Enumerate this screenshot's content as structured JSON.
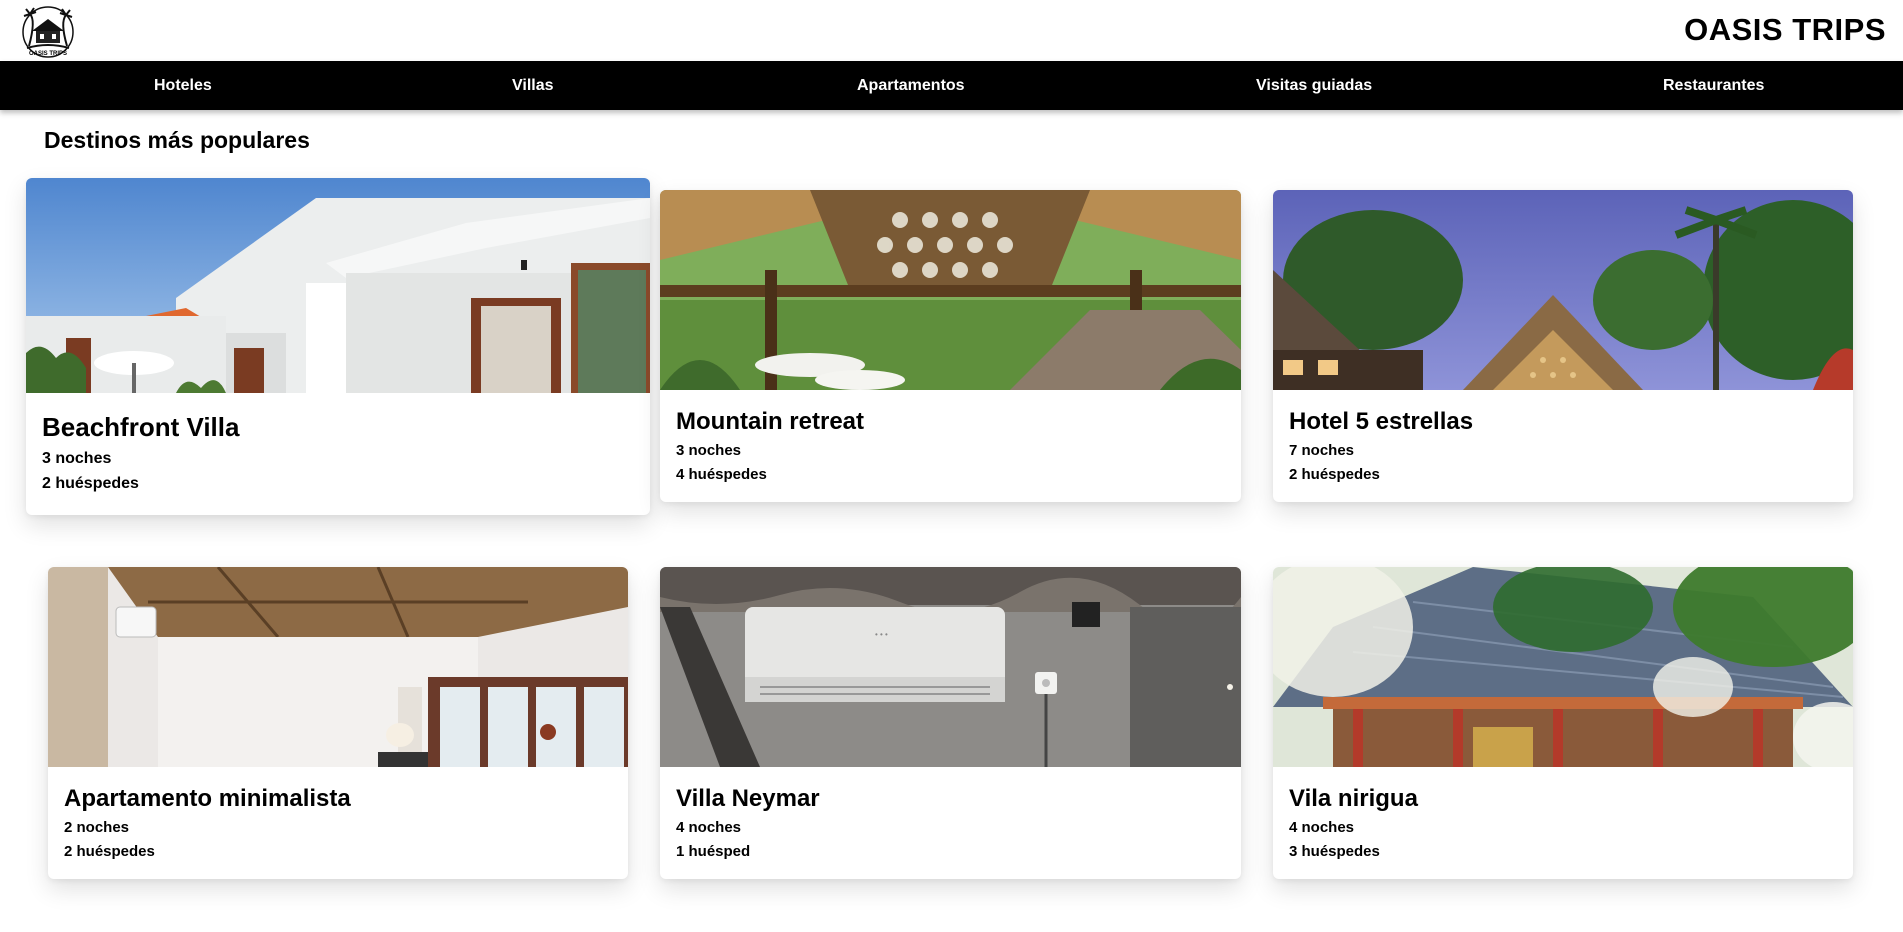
{
  "header": {
    "brand": "OASIS TRIPS",
    "logo_icon": "palm-tree-hut-logo"
  },
  "nav": {
    "items": [
      {
        "label": "Hoteles"
      },
      {
        "label": "Villas"
      },
      {
        "label": "Apartamentos"
      },
      {
        "label": "Visitas guiadas"
      },
      {
        "label": "Restaurantes"
      }
    ]
  },
  "main": {
    "section_title": "Destinos más populares",
    "cards": [
      {
        "title": "Beachfront Villa",
        "nights": "3 noches",
        "guests": "2 huéspedes",
        "image": "white-modern-villa-photo"
      },
      {
        "title": "Mountain retreat",
        "nights": "3 noches",
        "guests": "4 huéspedes",
        "image": "bamboo-pavilion-photo"
      },
      {
        "title": "Hotel 5 estrellas",
        "nights": "7 noches",
        "guests": "2 huéspedes",
        "image": "tropical-resort-dusk-photo"
      },
      {
        "title": "Apartamento minimalista",
        "nights": "2 noches",
        "guests": "2 huéspedes",
        "image": "minimalist-bedroom-photo"
      },
      {
        "title": "Villa Neymar",
        "nights": "4 noches",
        "guests": "1 huésped",
        "image": "air-conditioner-wall-photo"
      },
      {
        "title": "Vila nirigua",
        "nights": "4 noches",
        "guests": "3 huéspedes",
        "image": "balinese-temple-roof-photo"
      }
    ]
  }
}
